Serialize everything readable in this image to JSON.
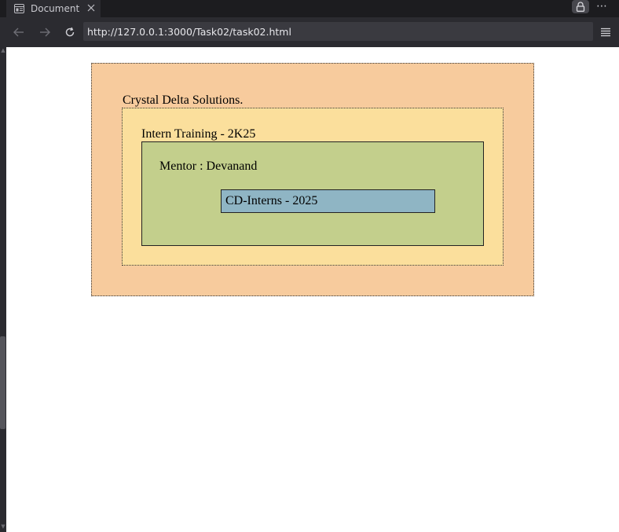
{
  "browser": {
    "tab_title": "Document",
    "url": "http://127.0.0.1:3000/Task02/task02.html",
    "icons": {
      "tab": "page-icon",
      "close": "close-icon",
      "back": "back-arrow-icon",
      "forward": "forward-arrow-icon",
      "reload": "reload-icon",
      "lock": "lock-icon",
      "more": "more-dots-icon",
      "menu": "hamburger-menu-icon"
    },
    "more_symbol": "⋯",
    "colors": {
      "chrome_dark": "#1c1c1f",
      "chrome": "#2b2b30",
      "url_field": "#3a3a40"
    }
  },
  "page": {
    "company": "Crystal Delta Solutions.",
    "training": "Intern Training - 2K25",
    "mentor": "Mentor : Devanand",
    "badge": "CD-Interns - 2025",
    "colors": {
      "outer_box": "#f7cb9d",
      "middle_box": "#fbdf9c",
      "inner_box": "#c3cf8c",
      "badge": "#8fb5c4"
    }
  }
}
